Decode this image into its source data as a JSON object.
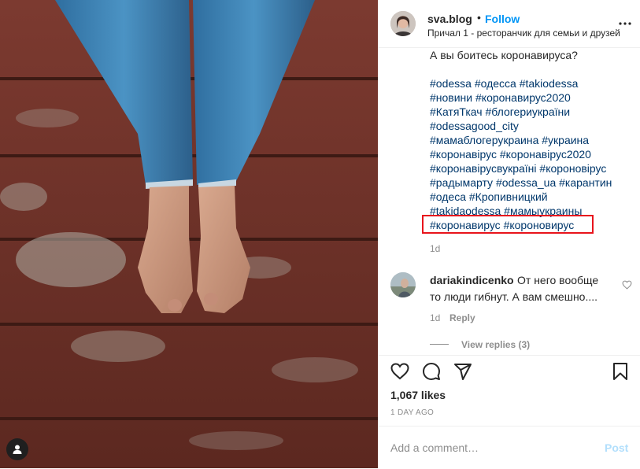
{
  "post": {
    "username": "sva.blog",
    "separator": "•",
    "follow_label": "Follow",
    "location": "Причал 1 - ресторанчик для семьи и друзей"
  },
  "caption": {
    "lines": [
      "А вы боитесь коронавируса?",
      "#odessa #одесса #takiodessa",
      "#новини #коронавирус2020",
      "#КатяТкач #блогериукраїни",
      "#odessagood_city",
      "#мамаблогерукраина #украина",
      "#коронавірус #коронавірус2020",
      "#коронавірусвукраїні #короновірус",
      "#радымарту #odessa_ua #карантин",
      "#одеса #Кропивницкий",
      "#takidaodessa #мамыукраины",
      "#коронавирус #короновирус"
    ],
    "time": "1d"
  },
  "comment": {
    "username": "dariakindicenko",
    "text_line1": "От него вообще",
    "text_line2": "то люди гибнут. А вам смешно....",
    "time": "1d",
    "reply_label": "Reply",
    "view_replies": "View replies (3)"
  },
  "stats": {
    "likes": "1,067 likes",
    "posted_ago": "1 DAY AGO"
  },
  "composer": {
    "placeholder": "Add a comment…",
    "post_label": "Post"
  },
  "icons": [
    "more-icon",
    "heart-icon",
    "comment-icon",
    "share-icon",
    "bookmark-icon",
    "user-tag-icon"
  ],
  "colors": {
    "follow": "#0095f6",
    "hashtag": "#00376b",
    "highlight": "#e8141c",
    "post_disabled": "#b2dffc"
  }
}
